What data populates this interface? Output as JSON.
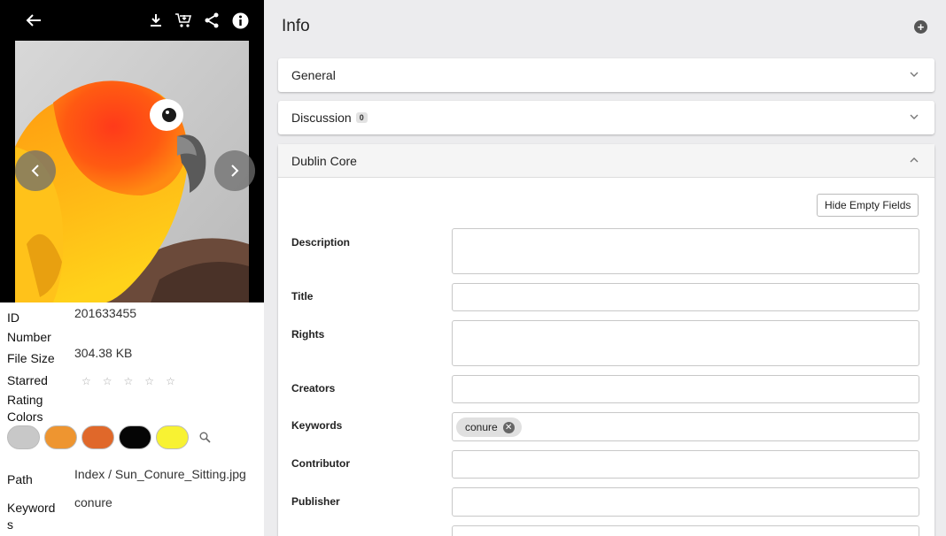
{
  "left_panel": {
    "toolbar": {
      "back_glyph": "←",
      "download_glyph": "⤓",
      "cart_glyph": "🛒",
      "share_glyph": "<",
      "info_glyph": "i"
    },
    "properties": {
      "id_label_line1": "ID",
      "id_label_line2": "Number",
      "id_value": "201633455",
      "filesize_label": "File Size",
      "filesize_value": "304.38 KB",
      "rating_label_line1": "Starred",
      "rating_label_line2": "Rating",
      "rating_stars": [
        "☆",
        "☆",
        "☆",
        "☆",
        "☆"
      ],
      "colors_label": "Colors",
      "colors": [
        "#c8c8c8",
        "#ee9530",
        "#e0682a",
        "#050505",
        "#f8f232"
      ],
      "path_label": "Path",
      "path_value": "Index / Sun_Conure_Sitting.jpg",
      "keywords_label_line1": "Keyword",
      "keywords_label_line2": "s",
      "keywords_value": "conure"
    }
  },
  "right_panel": {
    "title": "Info",
    "sections": [
      {
        "label": "General",
        "expanded": false
      },
      {
        "label": "Discussion",
        "count": "0",
        "expanded": false
      },
      {
        "label": "Dublin Core",
        "expanded": true
      }
    ],
    "dublin_core": {
      "hide_empty_label": "Hide Empty Fields",
      "fields": {
        "description": {
          "label": "Description",
          "value": ""
        },
        "title": {
          "label": "Title",
          "value": ""
        },
        "rights": {
          "label": "Rights",
          "value": ""
        },
        "creators": {
          "label": "Creators",
          "value": ""
        },
        "keywords": {
          "label": "Keywords",
          "chips": [
            "conure"
          ]
        },
        "contributor": {
          "label": "Contributor",
          "value": ""
        },
        "publisher": {
          "label": "Publisher",
          "value": ""
        }
      }
    }
  }
}
